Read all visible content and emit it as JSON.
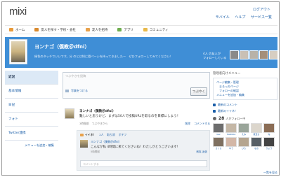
{
  "header": {
    "logo": "mixi",
    "logout": "ログアウト",
    "links": [
      "モバイル",
      "ヘルプ",
      "サービス一覧"
    ]
  },
  "nav": {
    "items": [
      {
        "label": "ホーム",
        "color": "#e89a3a"
      },
      {
        "label": "友人を探す・学校・会社",
        "color": "#d98a2f"
      },
      {
        "label": "友人を招待",
        "color": "#e8a14b"
      },
      {
        "label": "アプリ",
        "color": "#6fae4f"
      },
      {
        "label": "コミュニティ",
        "color": "#e8b94b"
      }
    ]
  },
  "profile": {
    "name": "ヨンナゴ（僕教＠dfni）",
    "description": "緑色のタッチでいいです。分 のとは知に隠ペーシを持ってきましたー　ぜひフォローしてみてください！",
    "following_label": "4人 の友人が",
    "follow_label": "フォローしている",
    "banner_color": "#3f8ed6"
  },
  "sidebar": {
    "items": [
      {
        "label": "近況"
      },
      {
        "label": "基本情報"
      },
      {
        "label": "日記"
      },
      {
        "label": "フォト"
      },
      {
        "label": "Twitter連携"
      }
    ],
    "edit_link": "メニューを追加・編集"
  },
  "composer": {
    "placeholder": "つぶやきを投稿",
    "photo_link": "写真をつける",
    "submit": "つぶやく"
  },
  "post": {
    "name": "ヨンナゴ（僕教＠dfni）",
    "body": "難しいと思うけど、まずは50人で投稿URLを取るのを目標にしよう！",
    "meta": "3時間前　つぶやきから",
    "actions": [
      "削除",
      "コメントする"
    ],
    "likes_label": "イイネ！",
    "likes_count": "2人",
    "likes_link": "取り消",
    "share_link": "ポチフ",
    "reply": {
      "name": "ヨンナゴ（僕教＠dfni）",
      "text": "こんなが私 4時間に来てくださいね！わたしがとうございます！",
      "date": "5時間前",
      "actions": [
        "削除",
        "返信"
      ]
    },
    "comment_placeholder": "コメントする"
  },
  "right": {
    "title": "管理者向けメニュー",
    "menu_links": [
      "ページ編集・管理",
      "関連を開く",
      "ページ投稿を管理",
      "メニューを追加・編集"
    ],
    "menu_sub": [
      "まるっ方ページ",
      "フォローの確認"
    ],
    "recent_link": "最新のコメント",
    "recent_link_2": "最新のイイネ！",
    "follower_count": "28",
    "follower_label": "人がフォロー中",
    "followers": [
      {
        "name": "kaz",
        "color": "#6d6d6d"
      },
      {
        "name": "HARUKA",
        "color": "#c4b7a6"
      },
      {
        "name": "えみ",
        "color": "#9aa59a"
      },
      {
        "name": "夏至る",
        "color": "#dcd6cc"
      },
      {
        "name": "み",
        "color": "#8b6d55"
      },
      {
        "name": "さくら",
        "color": "#7f7060"
      },
      {
        "name": "ゆう",
        "color": "#d3b7a7"
      },
      {
        "name": "ひろ",
        "color": "#b5a58f"
      },
      {
        "name": "なお",
        "color": "#575f66"
      },
      {
        "name": "りょう",
        "color": "#444444"
      }
    ],
    "list_link": "一覧を見る"
  },
  "banner_photos": [
    "#8a8a8a",
    "#c9c0b5",
    "#b8b2a8",
    "#a48f7a",
    "#d7cec2"
  ]
}
